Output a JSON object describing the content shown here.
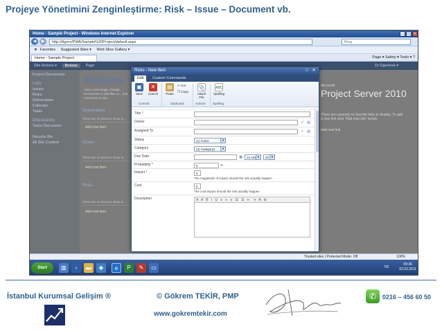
{
  "slide": {
    "title": "Projeye Yönetimini Zenginleştirme: Risk – Issue – Document vb."
  },
  "browser": {
    "window_title": "Home - Sample Project - Windows Internet Explorer",
    "address": "http://Agerv/PWA/Sample%20Project/default.aspx",
    "search_placeholder": "Bing",
    "favorites_label": "Favorites",
    "fav_links": [
      "Suggested Sites ▾",
      "Web Slice Gallery ▾"
    ],
    "tab_label": "Home - Sample Project",
    "command_items": "Page ▾   Safety ▾   Tools ▾   ?",
    "status_text": "Trusted sites | Protected Mode: Off",
    "zoom": "100%"
  },
  "sharepoint": {
    "ribbon": [
      "Site Actions ▾",
      "Browse",
      "Page"
    ],
    "user": "Dr.Ogemrek ▾",
    "left_nav": {
      "top": "Project Documents",
      "lists_header": "Lists",
      "lists": [
        "Issues",
        "Risks",
        "Deliverables",
        "Calendar",
        "Tasks"
      ],
      "discussions_header": "Discussions",
      "discussions": [
        "Team Discussion"
      ],
      "bottom": [
        "Recycle Bin",
        "All Site Content"
      ]
    },
    "welcome": "Welcome",
    "welcome_text": "Add a new image, change... Documents to add files or... and customize to kha...",
    "deliverables_title": "Deliverables",
    "issues_title": "Issues",
    "risks_title": "Risks",
    "empty_row": "There are no items to show in...",
    "add_item": "Add new item",
    "add_link": "Add new link",
    "logo_sub": "Microsoft",
    "logo_text": "Project Server 2010",
    "right_text": "There are currently no favorite links to display. To add a new link click \"Add new link\" below."
  },
  "dialog": {
    "title": "Risks - New Item",
    "tabs": [
      "Edit",
      "Custom Commands"
    ],
    "ribbon": {
      "save": "Save",
      "cancel": "Cancel",
      "paste": "Paste",
      "cut": "Cut",
      "copy": "Copy",
      "attach": "Attach File",
      "spelling": "Spelling",
      "groups": [
        "Commit",
        "Clipboard",
        "Actions",
        "Spelling"
      ]
    },
    "fields": {
      "title": "Title *",
      "owner": "Owner",
      "assigned_to": "Assigned To",
      "status": "Status",
      "status_value": "(1) Active",
      "category": "Category",
      "category_value": "(2) Category2",
      "due_date": "Due Date",
      "time_hour": "12 AM",
      "time_min": "00",
      "probability": "Probability *",
      "probability_value": "0",
      "percent": "%",
      "impact": "Impact *",
      "impact_value": "0",
      "impact_note": "The magnitude of impact should the risk actually happen",
      "cost": "Cost",
      "cost_value": "0",
      "cost_note": "The cost impact should the risk actually happen",
      "description": "Description",
      "rte_tools": "A A B I U ≡ ≡ ≡ ☰ ☰ ⇤ ⇥ A ⊕"
    }
  },
  "taskbar": {
    "start": "Start",
    "lang": "TR",
    "time": "09:36",
    "date": "02.02.2011"
  },
  "footer": {
    "company": "İstanbul Kurumsal Gelişim ®",
    "copyright_name": "© Gökrem TEKİR, PMP",
    "website": "www.gokremtekir.com",
    "phone": "0216 – 456 60 50"
  }
}
